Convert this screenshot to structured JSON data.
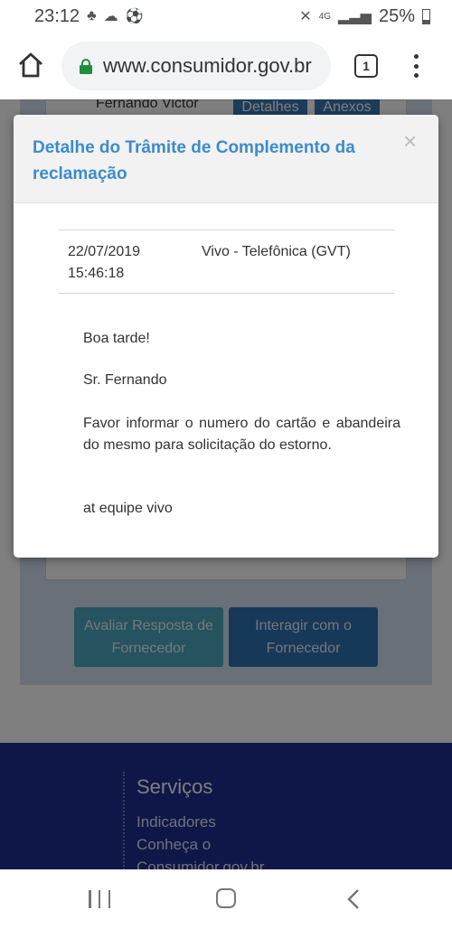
{
  "status_bar": {
    "time": "23:12",
    "battery": "25%",
    "network": "4G"
  },
  "browser": {
    "url": "www.consumidor.gov.br",
    "tab_count": "1"
  },
  "background_page": {
    "consumer_name_partial": "Fernando Victor",
    "tab_detalhes": "Detalhes",
    "tab_anexos": "Anexos",
    "avaliar_button": "Avaliar Resposta de Fornecedor",
    "interagir_button": "Interagir com o Fornecedor",
    "footer": {
      "title": "Serviços",
      "links": [
        "Indicadores",
        "Conheça o",
        "Consumidor.gov.br"
      ]
    }
  },
  "modal": {
    "title": "Detalhe do Trâmite de Complemento da reclamação",
    "close_symbol": "×",
    "entry": {
      "datetime": "22/07/2019 15:46:18",
      "company": "Vivo - Telefônica (GVT)"
    },
    "message": {
      "greeting": "Boa tarde!",
      "salutation": "Sr. Fernando",
      "body": "Favor informar o numero do cartão e abandeira do mesmo para solicitação do estorno.",
      "signature": "at equipe vivo"
    }
  },
  "colors": {
    "title_blue": "#3d8bcd",
    "footer_navy": "#1d2f8f",
    "button_teal": "#4aa6bf",
    "button_blue": "#2f73b2"
  }
}
